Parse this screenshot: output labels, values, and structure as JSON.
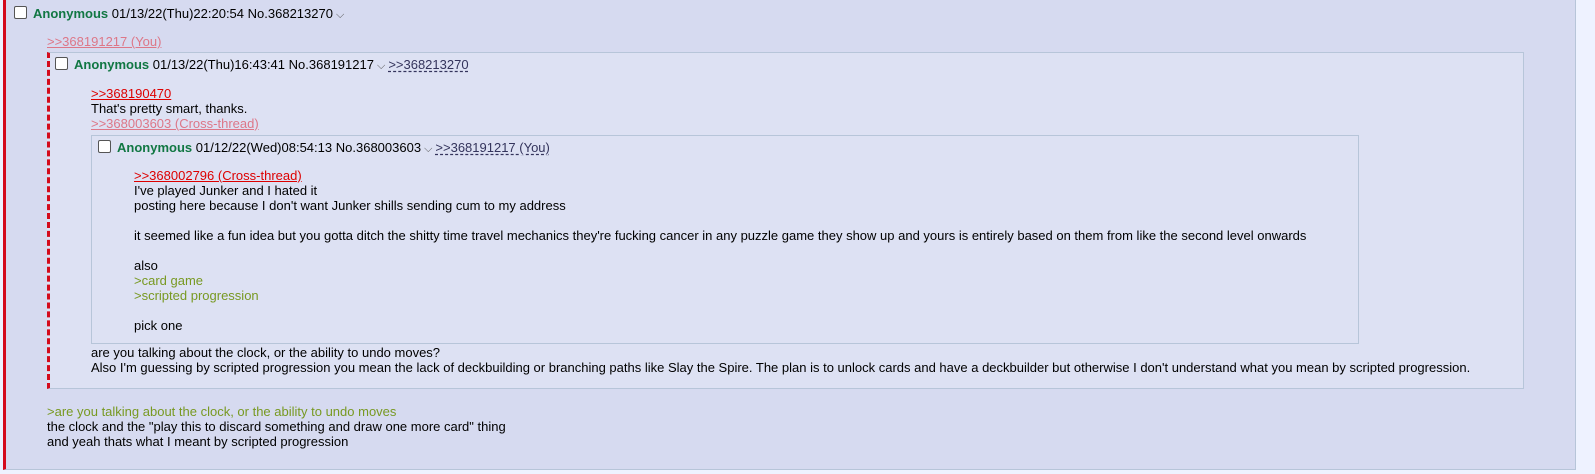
{
  "main": {
    "name": "Anonymous",
    "datetime": "01/13/22(Thu)22:20:54",
    "post_no": "No.368213270",
    "menu_glyph": "⌵",
    "quote_link": ">>368191217 (You)",
    "greentext": ">are you talking about the clock, or the ability to undo moves",
    "line_1": "the clock and the \"play this to discard something and draw one more card\" thing",
    "line_2": "and yeah thats what I meant by scripted progression"
  },
  "quoted": {
    "name": "Anonymous",
    "datetime": "01/13/22(Thu)16:43:41",
    "post_no": "No.368191217",
    "menu_glyph": "⌵",
    "backlink": ">>368213270",
    "reply_link": ">>368190470",
    "reply_text": "That's pretty smart, thanks.",
    "crossthread_link": ">>368003603 (Cross-thread)",
    "line_1": "are you talking about the clock, or the ability to undo moves?",
    "line_2": "Also I'm guessing by scripted progression you mean the lack of deckbuilding or branching paths like Slay the Spire. The plan is to unlock cards and have a deckbuilder but otherwise I don't understand what you mean by scripted progression."
  },
  "inner": {
    "name": "Anonymous",
    "datetime": "01/12/22(Wed)08:54:13",
    "post_no": "No.368003603",
    "menu_glyph": "⌵",
    "backlink": ">>368191217 (You)",
    "crossthread_link": ">>368002796 (Cross-thread)",
    "line_1": "I've played Junker and I hated it",
    "line_2": "posting here because I don't want Junker shills sending cum to my address",
    "line_3": "it seemed like a fun idea but you gotta ditch the shitty time travel mechanics they're fucking cancer in any puzzle game they show up and yours is entirely based on them from like the second level onwards",
    "line_4": "also",
    "greentext_1": ">card game",
    "greentext_2": ">scripted progression",
    "line_5": "pick one"
  },
  "colors": {
    "post_bg": "#d6daf0",
    "nested_bg": "#dde1f3",
    "name": "#117743",
    "quote_link": "#dd0000",
    "greentext": "#789922",
    "highlight_border": "#d40a1c"
  }
}
